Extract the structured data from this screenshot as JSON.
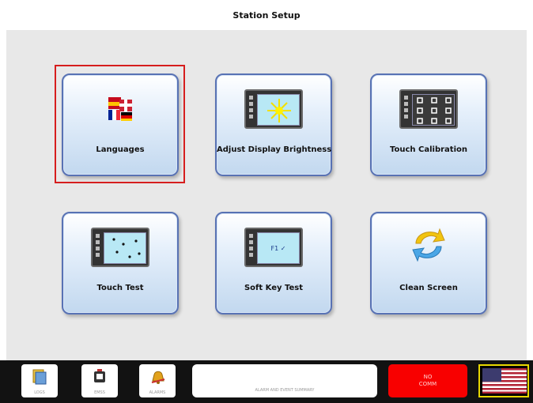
{
  "header": {
    "title": "Station Setup"
  },
  "tiles": [
    {
      "label": "Languages",
      "selected": true,
      "icon": "flags-icon"
    },
    {
      "label": "Adjust Display Brightness",
      "icon": "brightness-icon"
    },
    {
      "label": "Touch Calibration",
      "icon": "calibration-grid-icon"
    },
    {
      "label": "Touch Test",
      "icon": "touch-test-icon"
    },
    {
      "label": "Soft Key Test",
      "icon": "soft-key-icon"
    },
    {
      "label": "Clean Screen",
      "icon": "clean-screen-arrows-icon"
    }
  ],
  "softkey_text": "F1 ✓",
  "footer": {
    "logs_label": "LOGS",
    "ems_label": "EMSS",
    "alarms_label": "ALARMS",
    "summary_label": "ALARM AND EVENT SUMMARY",
    "status_line1": "NO",
    "status_line2": "COMM",
    "flag": "us-flag-icon"
  },
  "colors": {
    "selection": "#d61e1e",
    "status_bg": "#f80000",
    "tile_border": "#5872b4",
    "flag_border": "#e8d800"
  }
}
